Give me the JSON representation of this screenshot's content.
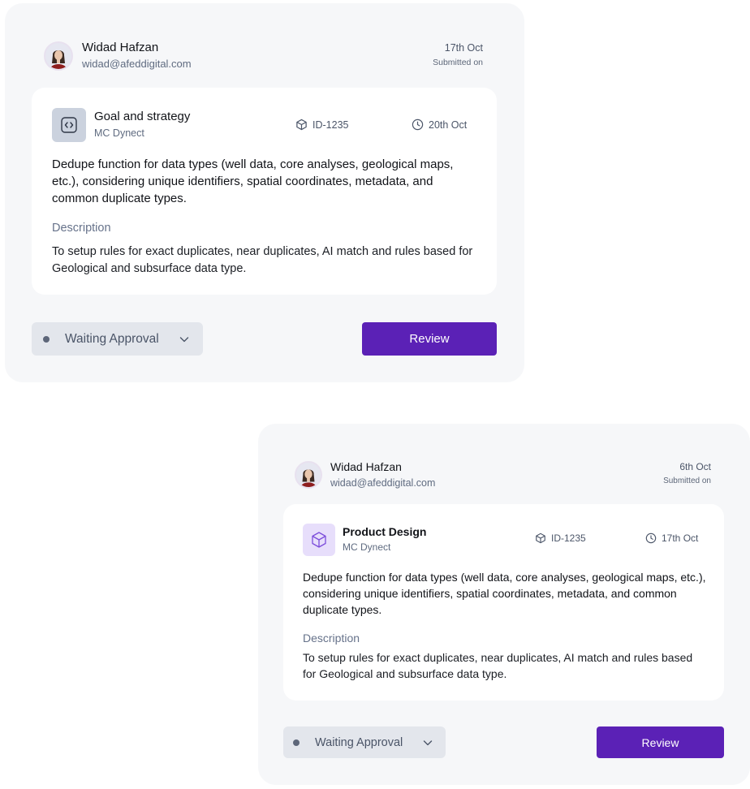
{
  "cards": [
    {
      "submitter": {
        "name": "Widad Hafzan",
        "email": "widad@afeddigital.com"
      },
      "submitted": {
        "date": "17th Oct",
        "label": "Submitted on"
      },
      "category": {
        "title": "Goal and strategy",
        "subtitle": "MC Dynect",
        "icon": "code-icon"
      },
      "id_label": "ID-1235",
      "due_date": "20th Oct",
      "summary": "Dedupe function for data types (well data, core analyses, geological maps, etc.), considering unique identifiers, spatial coordinates, metadata,  and common duplicate types.",
      "description_label": "Description",
      "description": "To setup rules for exact duplicates, near duplicates, AI match and rules based for Geological and subsurface data type.",
      "status": "Waiting Approval",
      "review_label": "Review"
    },
    {
      "submitter": {
        "name": "Widad Hafzan",
        "email": "widad@afeddigital.com"
      },
      "submitted": {
        "date": "6th Oct",
        "label": "Submitted on"
      },
      "category": {
        "title": "Product Design",
        "subtitle": "MC Dynect",
        "icon": "cube-icon"
      },
      "id_label": "ID-1235",
      "due_date": "17th Oct",
      "summary": "Dedupe function for data types (well data, core analyses, geological maps, etc.), considering unique identifiers, spatial coordinates, metadata,  and common duplicate types.",
      "description_label": "Description",
      "description": "To setup rules for exact duplicates, near duplicates, AI match and rules based for Geological and subsurface data type.",
      "status": "Waiting Approval",
      "review_label": "Review"
    }
  ],
  "colors": {
    "accent": "#5b21b6",
    "card_bg": "#f6f7f9",
    "status_bg": "#e3e6ec",
    "code_icon_bg": "#cbd2de",
    "cube_icon_bg": "#e7defb"
  }
}
